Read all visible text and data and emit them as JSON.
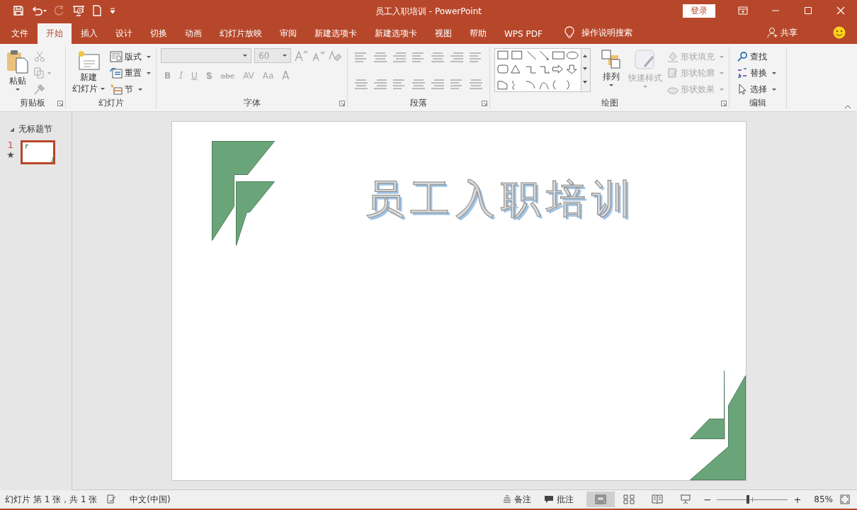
{
  "window": {
    "title": "员工入职培训  -  PowerPoint",
    "login": "登录"
  },
  "tabs": [
    {
      "label": "文件",
      "selected": false
    },
    {
      "label": "开始",
      "selected": true
    },
    {
      "label": "插入",
      "selected": false
    },
    {
      "label": "设计",
      "selected": false
    },
    {
      "label": "切换",
      "selected": false
    },
    {
      "label": "动画",
      "selected": false
    },
    {
      "label": "幻灯片放映",
      "selected": false
    },
    {
      "label": "审阅",
      "selected": false
    },
    {
      "label": "新建选项卡",
      "selected": false
    },
    {
      "label": "新建选项卡",
      "selected": false
    },
    {
      "label": "视图",
      "selected": false
    },
    {
      "label": "帮助",
      "selected": false
    },
    {
      "label": "WPS PDF",
      "selected": false
    }
  ],
  "tell_me": "操作说明搜索",
  "share": "共享",
  "ribbon": {
    "clipboard": {
      "label": "剪贴板",
      "paste": "粘贴"
    },
    "slides": {
      "label": "幻灯片",
      "new_slide": [
        "新建",
        "幻灯片"
      ],
      "commands": [
        {
          "label": "版式",
          "kind": "layout"
        },
        {
          "label": "重置",
          "kind": "reset"
        },
        {
          "label": "节",
          "kind": "section"
        }
      ]
    },
    "font": {
      "label": "字体",
      "size": "60",
      "disabled": true,
      "buttons": [
        "B",
        "I",
        "U",
        "S",
        "abc",
        "AV",
        "Aa",
        "A"
      ]
    },
    "paragraph": {
      "label": "段落"
    },
    "drawing": {
      "label": "绘图",
      "arrange": "排列",
      "quick_styles": {
        "label": "快速样式",
        "disabled": true
      },
      "shape_commands": [
        {
          "label": "形状填充",
          "disabled": true
        },
        {
          "label": "形状轮廓",
          "disabled": true
        },
        {
          "label": "形状效果",
          "disabled": true
        }
      ]
    },
    "editing": {
      "label": "编辑",
      "commands": [
        {
          "label": "查找",
          "kind": "find"
        },
        {
          "label": "替换",
          "kind": "replace"
        },
        {
          "label": "选择",
          "kind": "select"
        }
      ]
    }
  },
  "slides_pane": {
    "section": "无标题节",
    "slides": [
      {
        "number": "1",
        "selected": true
      }
    ]
  },
  "slide": {
    "title": "员工入职培训"
  },
  "status_bar": {
    "slide_info": "幻灯片 第 1 张，共 1 张",
    "language": "中文(中国)",
    "notes": "备注",
    "comments": "批注",
    "views": [
      {
        "kind": "normal",
        "selected": true
      },
      {
        "kind": "sorter",
        "selected": false
      },
      {
        "kind": "reading",
        "selected": false
      },
      {
        "kind": "slideshow",
        "selected": false
      }
    ],
    "zoom": {
      "minus": "−",
      "plus": "+",
      "level": 0.42,
      "reading": "85%"
    }
  }
}
